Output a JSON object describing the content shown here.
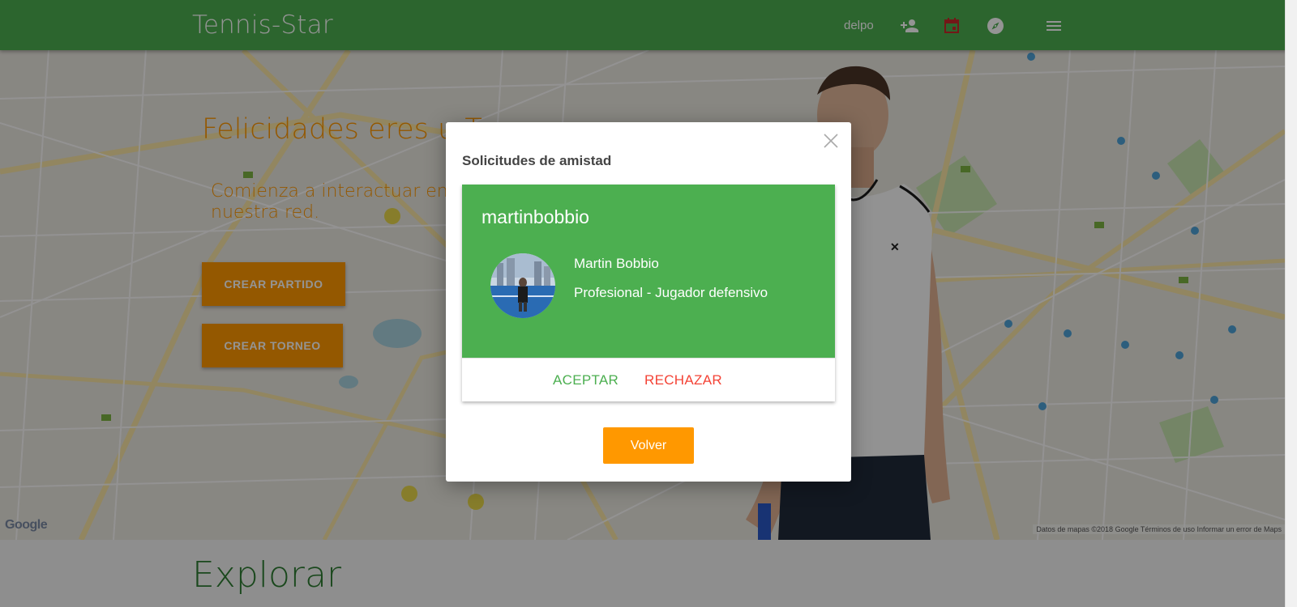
{
  "navbar": {
    "brand": "Tennis-Star",
    "username": "delpo",
    "icons": [
      "friends-icon",
      "calendar-icon",
      "compass-icon",
      "menu-icon"
    ],
    "bg_color": "#4caf50"
  },
  "hero": {
    "title": "Felicidades eres u",
    "title_partial_tail": "T",
    "subtitle": "Comienza a interactuar en nuestra red.",
    "buttons": {
      "crear_partido": "CREAR PARTIDO",
      "crear_torneo": "CREAR TORNEO"
    },
    "map_attribution": "Google",
    "map_terms": "Datos de mapas ©2018 Google   Términos de uso   Informar un error de Maps",
    "accent_color": "#ff9800"
  },
  "explore": {
    "title": "Explorar"
  },
  "modal": {
    "title": "Solicitudes de amistad",
    "request": {
      "username": "martinbobbio",
      "full_name": "Martin Bobbio",
      "level": "Profesional - Jugador defensivo"
    },
    "accept_label": "ACEPTAR",
    "reject_label": "RECHAZAR",
    "back_label": "Volver"
  }
}
